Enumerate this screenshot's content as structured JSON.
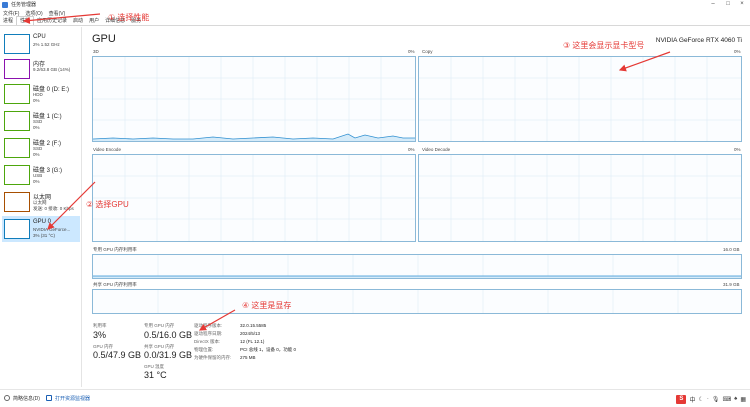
{
  "window": {
    "title": "任务管理器",
    "controls": [
      "–",
      "□",
      "×"
    ]
  },
  "menu": [
    "文件(F)",
    "选项(O)",
    "查看(V)"
  ],
  "tabs": [
    {
      "label": "进程",
      "active": false
    },
    {
      "label": "性能",
      "active": true
    },
    {
      "label": "应用历史记录",
      "active": false
    },
    {
      "label": "启动",
      "active": false
    },
    {
      "label": "用户",
      "active": false
    },
    {
      "label": "详细信息",
      "active": false
    },
    {
      "label": "服务",
      "active": false
    }
  ],
  "sidebar": [
    {
      "name": "CPU",
      "l1": "2% 1.52 GHz",
      "l2": "",
      "color": "#117dbb"
    },
    {
      "name": "内存",
      "l1": "9.2/63.8 GB (14%)",
      "l2": "",
      "color": "#8b12ae"
    },
    {
      "name": "磁盘 0 (D: E:)",
      "l1": "HDD",
      "l2": "0%",
      "color": "#4da60c"
    },
    {
      "name": "磁盘 1 (C:)",
      "l1": "SSD",
      "l2": "0%",
      "color": "#4da60c"
    },
    {
      "name": "磁盘 2 (F:)",
      "l1": "SSD",
      "l2": "0%",
      "color": "#4da60c"
    },
    {
      "name": "磁盘 3 (G:)",
      "l1": "USB",
      "l2": "0%",
      "color": "#4da60c"
    },
    {
      "name": "以太网",
      "l1": "以太网",
      "l2": "发送: 0 接收: 0 Kbps",
      "color": "#a74f01"
    },
    {
      "name": "GPU 0",
      "l1": "NVIDIA GeForce...",
      "l2": "3% (31 °C)",
      "color": "#117dbb"
    }
  ],
  "main": {
    "title": "GPU",
    "model": "NVIDIA GeForce RTX 4060 Ti",
    "graphs": [
      {
        "label": "3D",
        "pct": "0%"
      },
      {
        "label": "Copy",
        "pct": "0%"
      },
      {
        "label": "Video Encode",
        "pct": "0%"
      },
      {
        "label": "Video Decode",
        "pct": "0%"
      }
    ],
    "dedicated_mem": {
      "label": "专用 GPU 内存利用率",
      "max": "16.0 GB"
    },
    "shared_mem": {
      "label": "共享 GPU 内存利用率",
      "max": "31.9 GB"
    },
    "stats": {
      "utilization": {
        "label": "利用率",
        "value": "3%"
      },
      "dedicated": {
        "label": "专用 GPU 内存",
        "value": "0.5/16.0 GB"
      },
      "gpu_mem": {
        "label": "GPU 内存",
        "value": "0.5/47.9 GB"
      },
      "shared": {
        "label": "共享 GPU 内存",
        "value": "0.0/31.9 GB"
      },
      "temp": {
        "label": "GPU 温度",
        "value": "31 °C"
      }
    },
    "details": [
      {
        "key": "驱动程序版本:",
        "val": "32.0.15.5585"
      },
      {
        "key": "驱动程序日期:",
        "val": "2024/5/13"
      },
      {
        "key": "DirectX 版本:",
        "val": "12 (FL 12.1)"
      },
      {
        "key": "物理位置:",
        "val": "PCI 总线 1，设备 0，功能 0"
      },
      {
        "key": "为硬件保留的内存:",
        "val": "275 MB"
      }
    ]
  },
  "footer": {
    "summary": "简略信息(D)",
    "monitor": "打开资源监视器"
  },
  "tray": {
    "ime": "中"
  },
  "annotations": {
    "a1": "① 选择性能",
    "a2": "② 选择GPU",
    "a3": "③ 这里会显示显卡型号",
    "a4": "④ 这里是显存"
  }
}
